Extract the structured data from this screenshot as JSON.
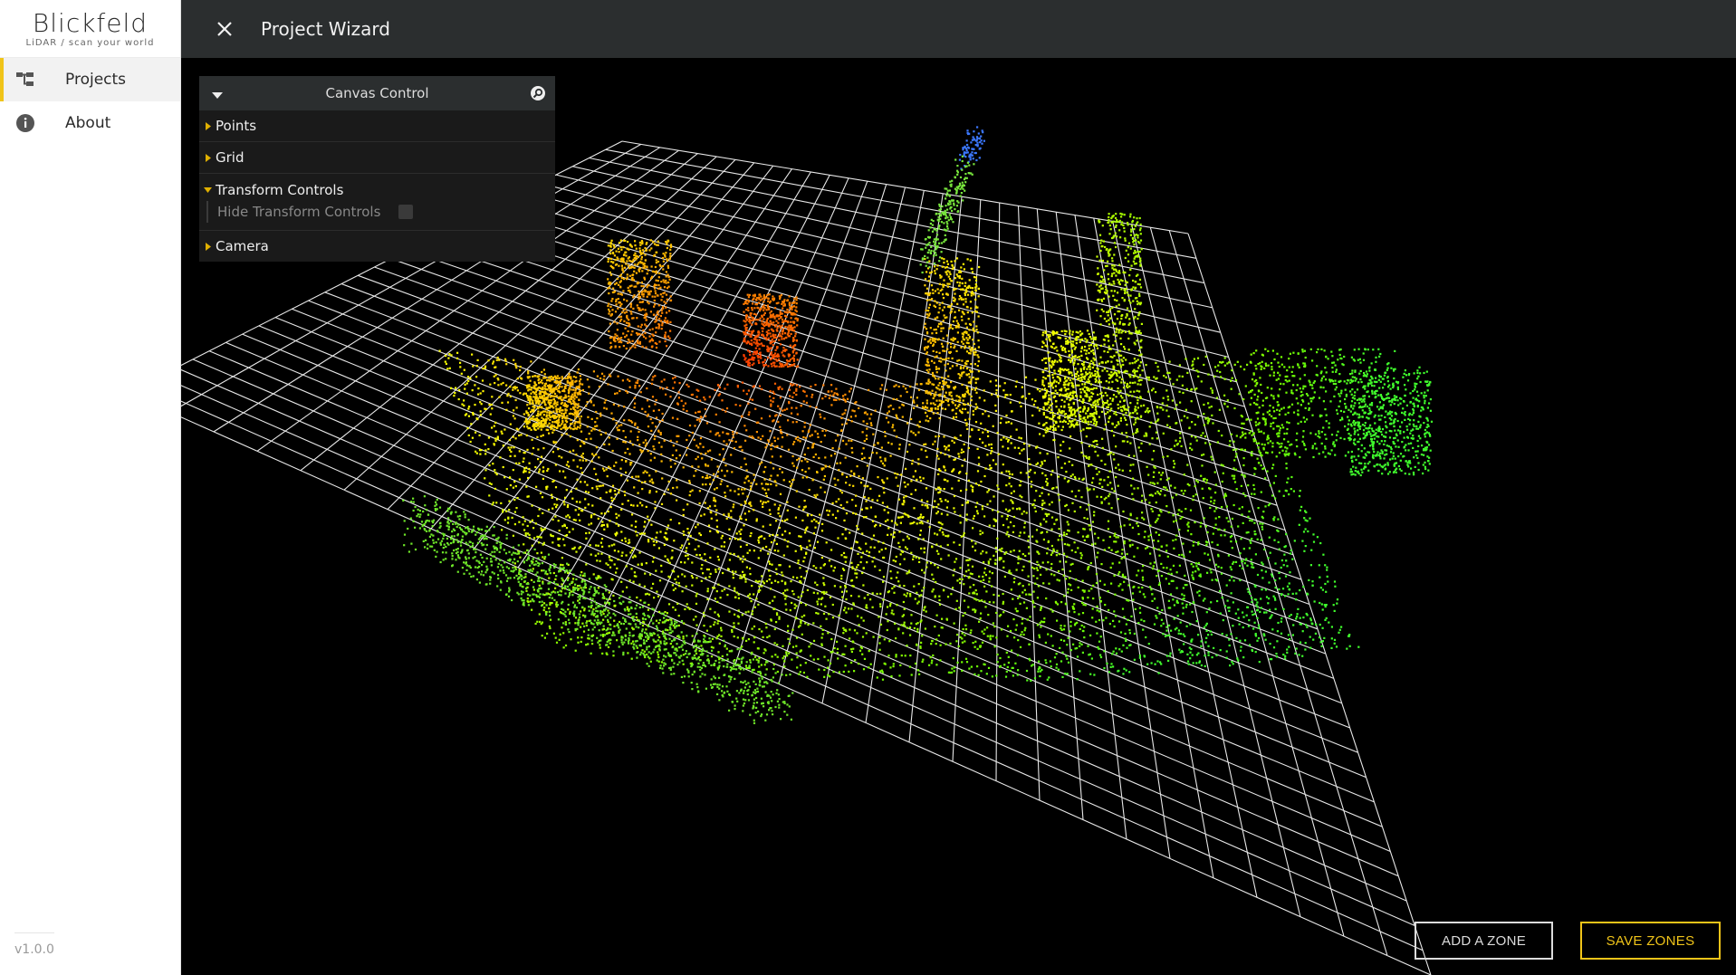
{
  "brand": {
    "name": "Blickfeld",
    "tagline": "LiDAR / scan your world"
  },
  "sidebar": {
    "items": [
      {
        "label": "Projects",
        "icon": "projects-tree-icon",
        "active": true
      },
      {
        "label": "About",
        "icon": "info-icon",
        "active": false
      }
    ],
    "version": "v1.0.0"
  },
  "header": {
    "title": "Project Wizard",
    "close_icon": "close-icon"
  },
  "canvas_control": {
    "title": "Canvas Control",
    "folders": [
      {
        "label": "Points",
        "open": false
      },
      {
        "label": "Grid",
        "open": false
      },
      {
        "label": "Transform Controls",
        "open": true,
        "rows": [
          {
            "label": "Hide Transform Controls",
            "checked": false
          }
        ]
      },
      {
        "label": "Camera",
        "open": false
      }
    ]
  },
  "actions": {
    "add_zone": "ADD A ZONE",
    "save_zones": "SAVE ZONES"
  },
  "colors": {
    "accent": "#f0c419",
    "header_bg": "#2b2e2f",
    "canvas_bg": "#000000",
    "grid_line": "#ffffff"
  }
}
